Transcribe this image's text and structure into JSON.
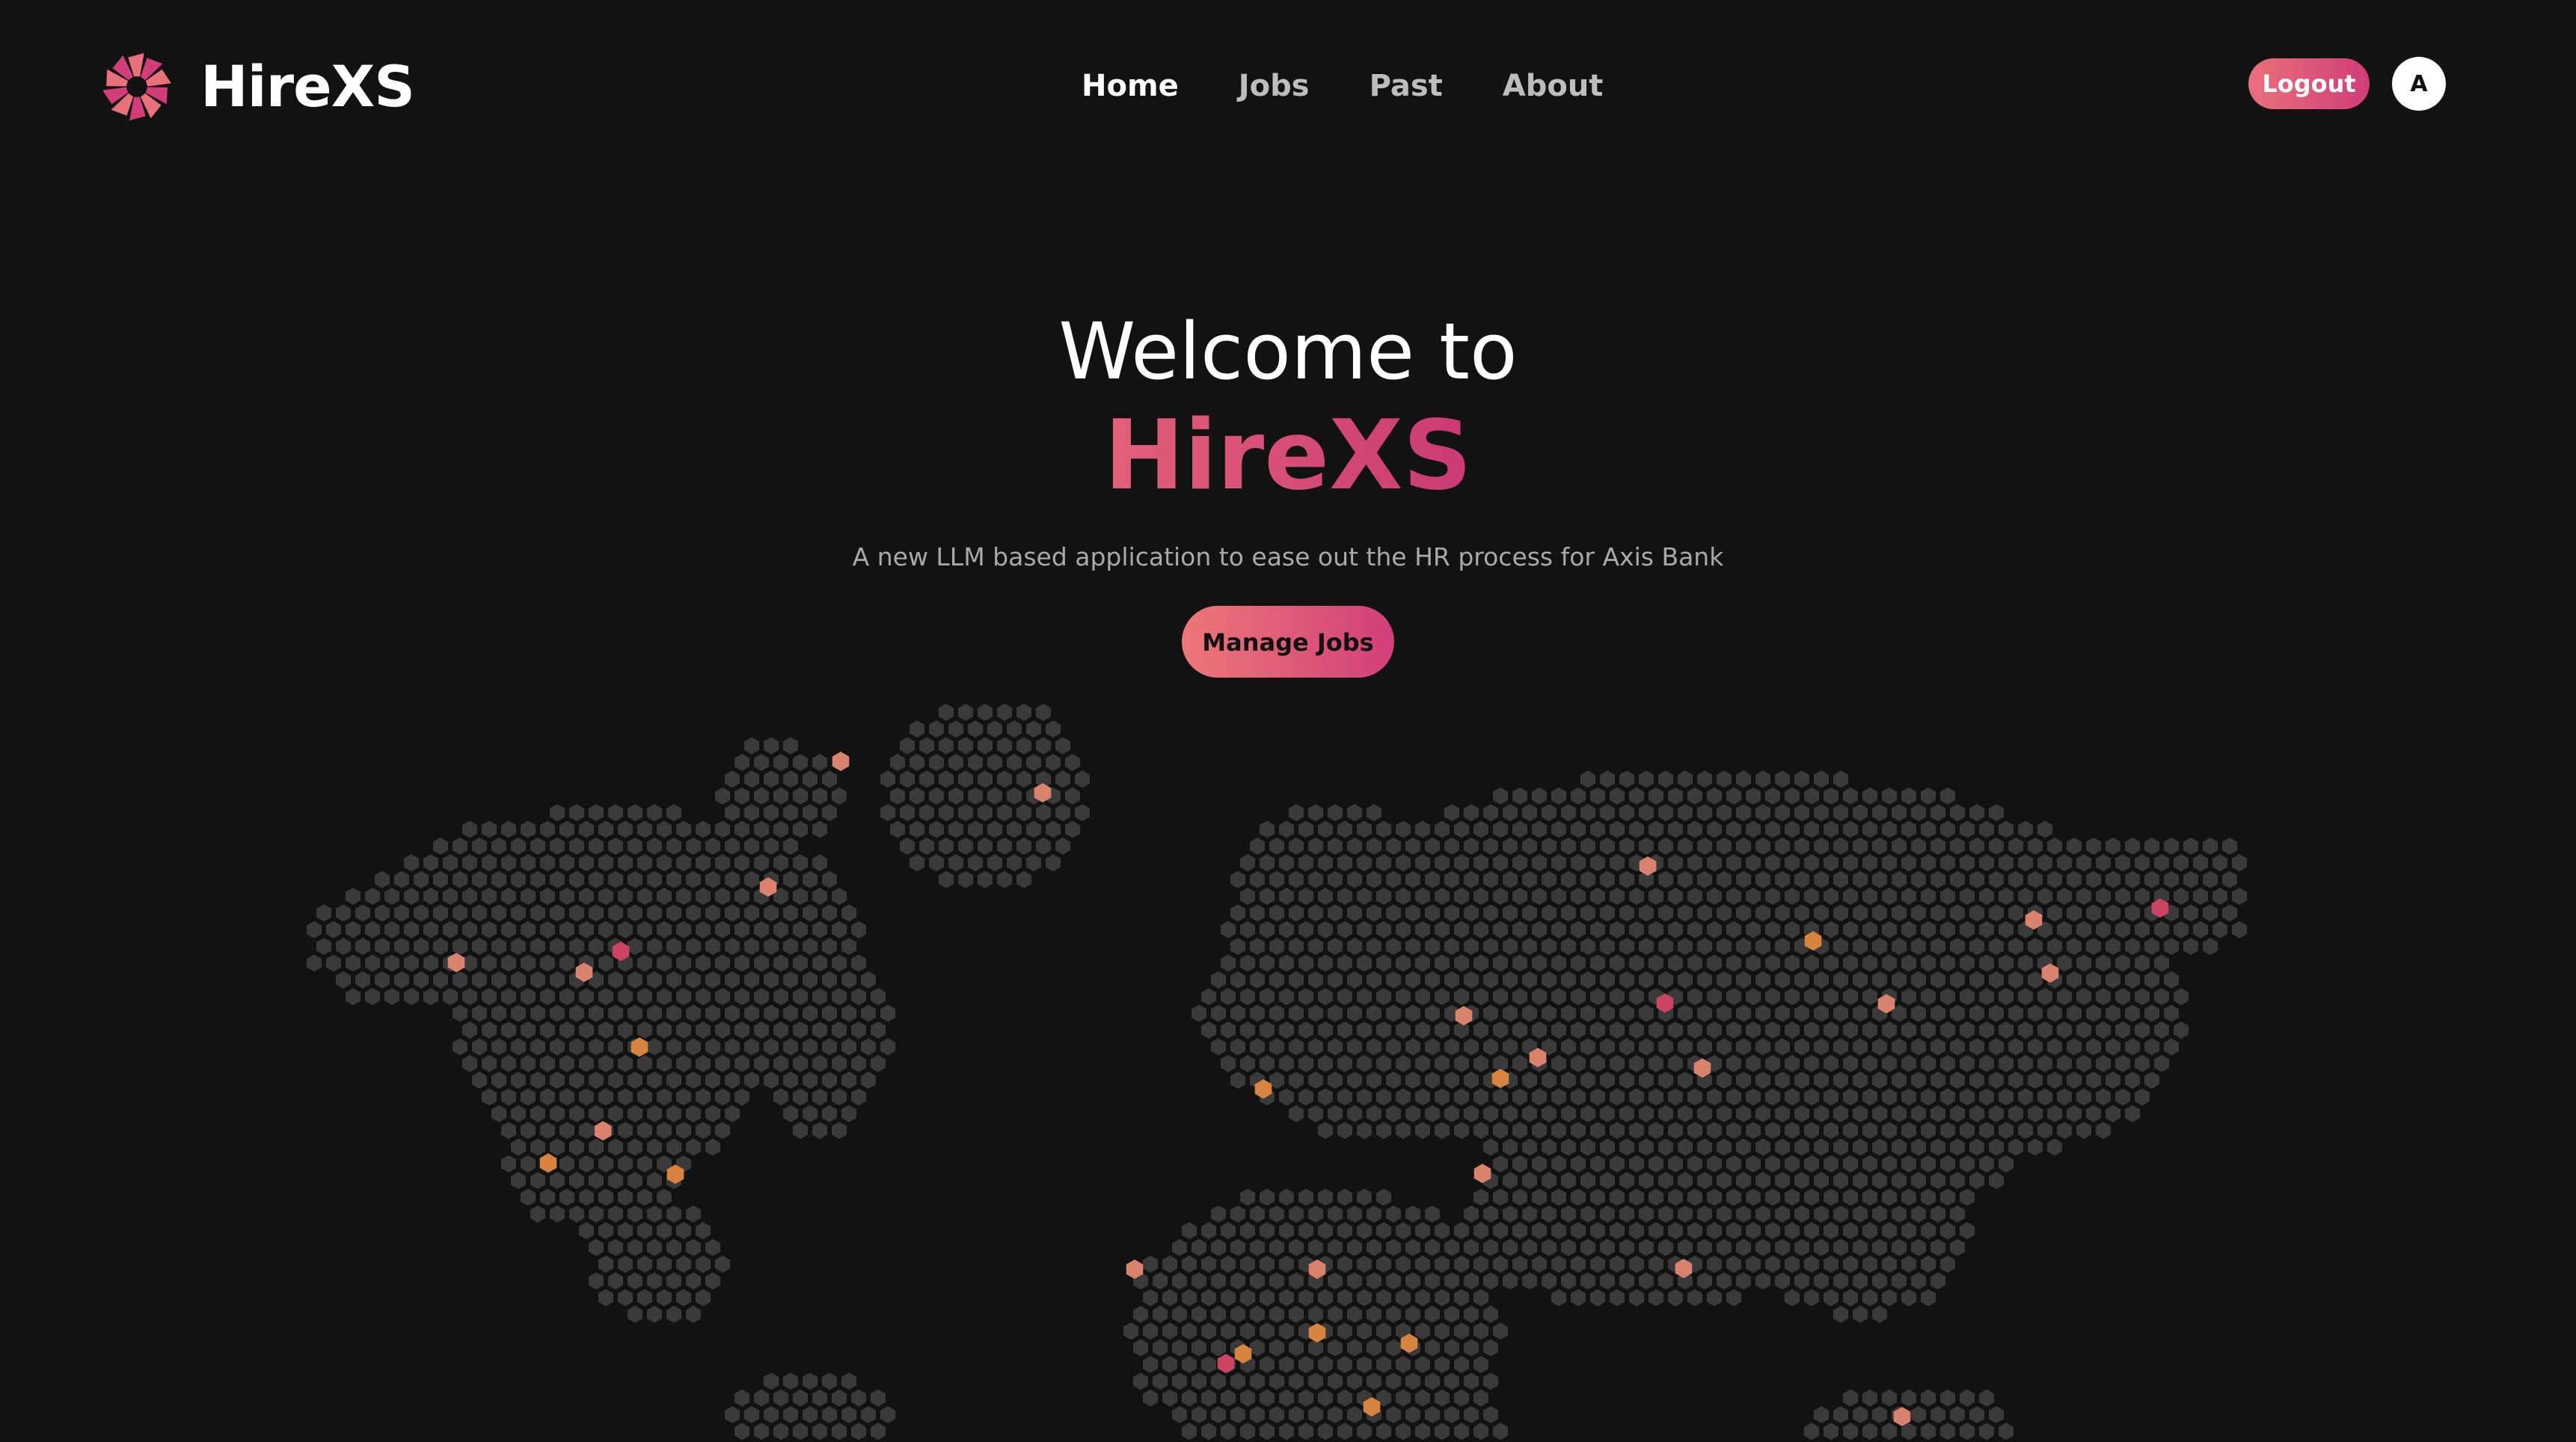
{
  "app": {
    "brand": "HireXS"
  },
  "nav": {
    "items": [
      {
        "label": "Home",
        "active": true
      },
      {
        "label": "Jobs",
        "active": false
      },
      {
        "label": "Past",
        "active": false
      },
      {
        "label": "About",
        "active": false
      }
    ]
  },
  "header": {
    "logout_label": "Logout",
    "avatar_initial": "A"
  },
  "hero": {
    "welcome": "Welcome to",
    "brand": "HireXS",
    "subtitle": "A new LLM based application to ease out the HR process for Axis Bank",
    "cta_label": "Manage Jobs"
  },
  "colors": {
    "background": "#121212",
    "accent_start": "#e8717b",
    "accent_end": "#d03d78",
    "map_dot": "#3a3a3a",
    "marker_salmon": "#d9826e",
    "marker_orange": "#d6843f",
    "marker_crimson": "#c94562"
  },
  "icons": {
    "logo": "pinwheel-logo-icon",
    "map": "hexagon-world-map"
  }
}
